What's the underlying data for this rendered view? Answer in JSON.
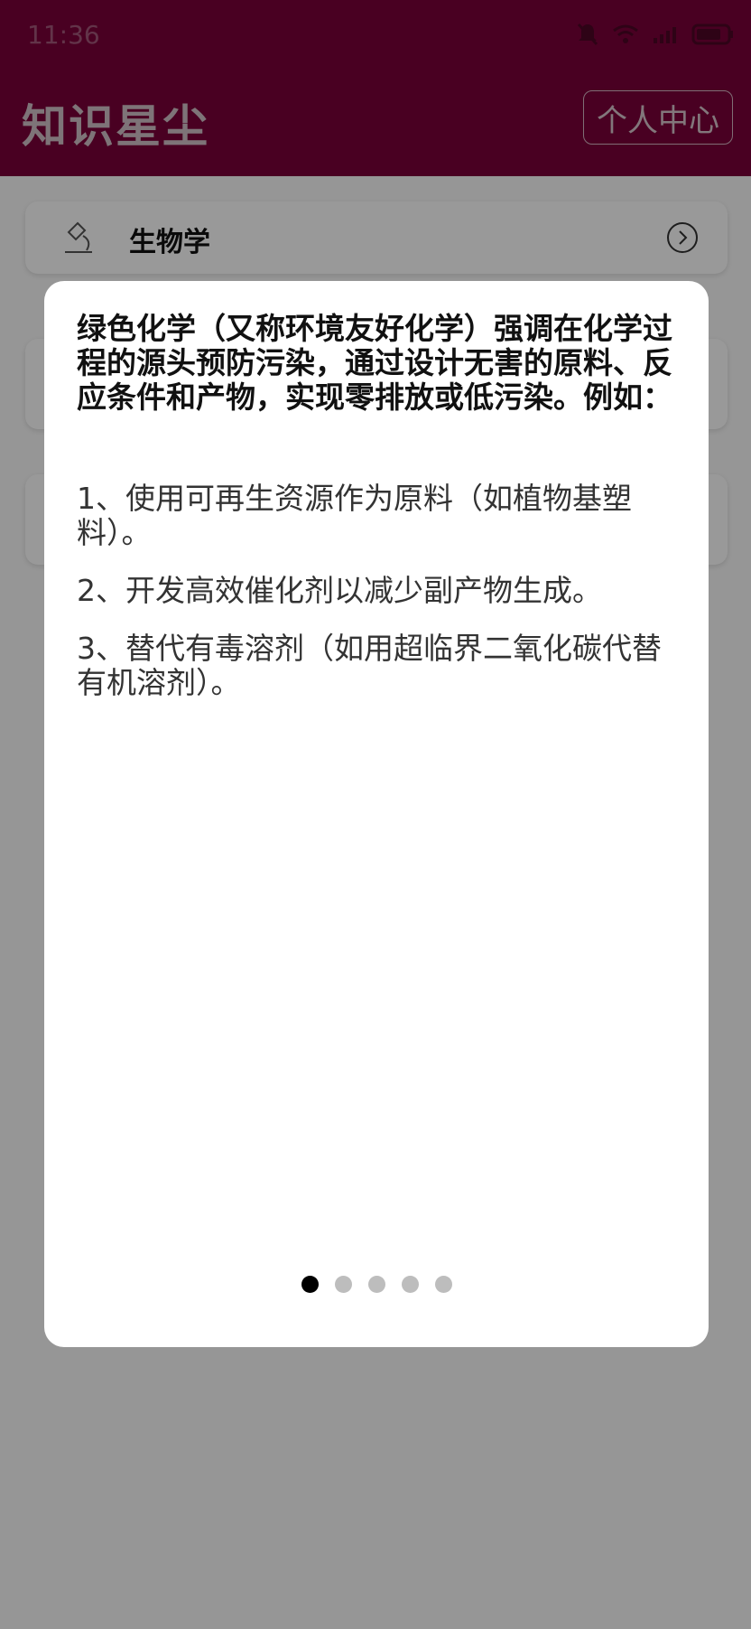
{
  "status_bar": {
    "time": "11:36",
    "icons": [
      "bell-off-icon",
      "wifi-icon",
      "signal-icon",
      "battery-icon"
    ]
  },
  "app_bar": {
    "title": "知识星尘",
    "profile_button": "个人中心"
  },
  "cards": [
    {
      "label": "生物学",
      "icon": "microscope-icon"
    },
    {
      "label": ""
    },
    {
      "label": ""
    }
  ],
  "dialog": {
    "intro": "绿色化学（又称环境友好化学）强调在化学过程的源头预防污染，通过设计无害的原料、反应条件和产物，实现零排放或低污染。例如：",
    "items": [
      "1、使用可再生资源作为原料（如植物基塑料）。",
      "2、开发高效催化剂以减少副产物生成。",
      "3、替代有毒溶剂（如用超临界二氧化碳代替有机溶剂）。"
    ],
    "page_count": 5,
    "active_page": 1
  },
  "colors": {
    "primary": "#7a003a",
    "scrim": "rgba(0,0,0,0.4)",
    "dot_active": "#000000",
    "dot_inactive": "#bdbdbd"
  }
}
